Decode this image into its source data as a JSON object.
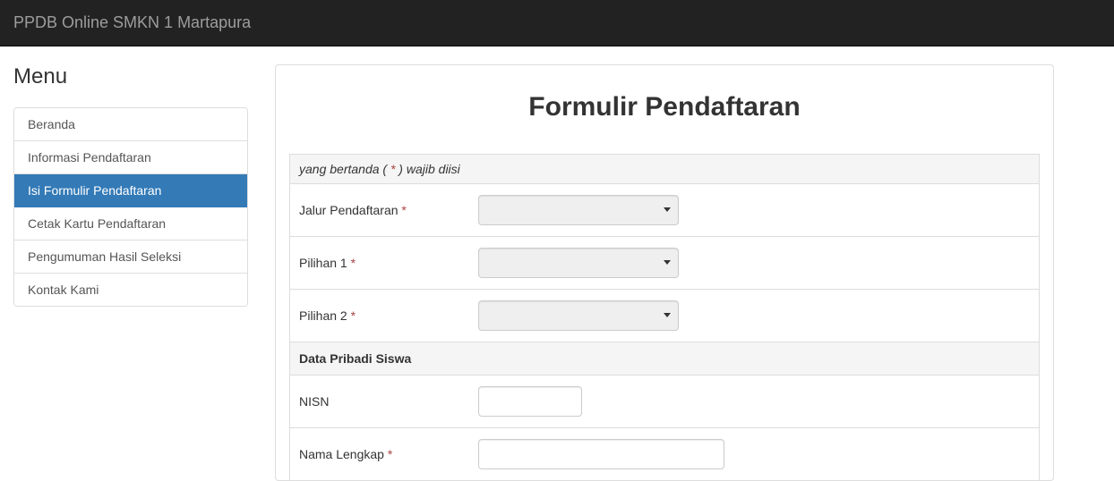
{
  "navbar": {
    "brand": "PPDB Online SMKN 1 Martapura"
  },
  "sidebar": {
    "heading": "Menu",
    "items": [
      {
        "label": "Beranda",
        "active": false
      },
      {
        "label": "Informasi Pendaftaran",
        "active": false
      },
      {
        "label": "Isi Formulir Pendaftaran",
        "active": true
      },
      {
        "label": "Cetak Kartu Pendaftaran",
        "active": false
      },
      {
        "label": "Pengumuman Hasil Seleksi",
        "active": false
      },
      {
        "label": "Kontak Kami",
        "active": false
      }
    ]
  },
  "main": {
    "title": "Formulir Pendaftaran",
    "note_prefix": "yang bertanda ( ",
    "note_star": "*",
    "note_suffix": " )  wajib diisi",
    "fields": {
      "jalur_label": "Jalur Pendaftaran ",
      "pilihan1_label": "Pilihan 1 ",
      "pilihan2_label": "Pilihan 2 ",
      "section_data_pribadi": "Data Pribadi Siswa",
      "nisn_label": "NISN",
      "nama_label": "Nama Lengkap "
    },
    "required_mark": "*"
  }
}
